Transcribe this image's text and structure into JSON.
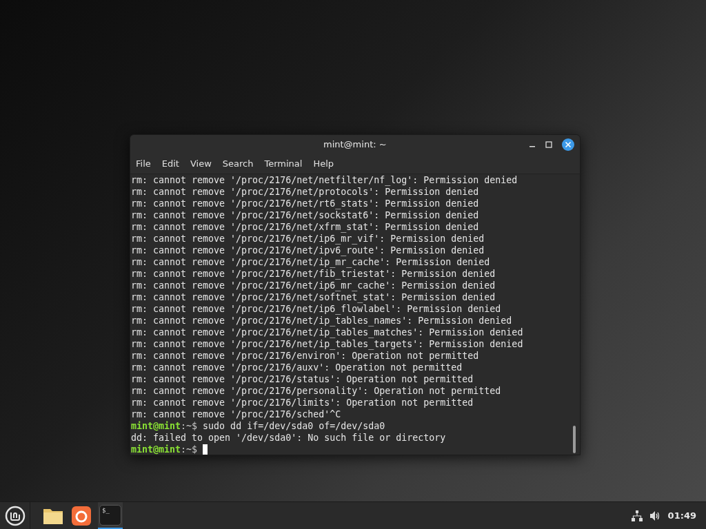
{
  "window": {
    "title": "mint@mint: ~",
    "menu": [
      "File",
      "Edit",
      "View",
      "Search",
      "Terminal",
      "Help"
    ]
  },
  "terminal": {
    "lines": [
      {
        "kind": "output",
        "text": "rm: cannot remove '/proc/2176/net/netfilter/nf_log': Permission denied"
      },
      {
        "kind": "output",
        "text": "rm: cannot remove '/proc/2176/net/protocols': Permission denied"
      },
      {
        "kind": "output",
        "text": "rm: cannot remove '/proc/2176/net/rt6_stats': Permission denied"
      },
      {
        "kind": "output",
        "text": "rm: cannot remove '/proc/2176/net/sockstat6': Permission denied"
      },
      {
        "kind": "output",
        "text": "rm: cannot remove '/proc/2176/net/xfrm_stat': Permission denied"
      },
      {
        "kind": "output",
        "text": "rm: cannot remove '/proc/2176/net/ip6_mr_vif': Permission denied"
      },
      {
        "kind": "output",
        "text": "rm: cannot remove '/proc/2176/net/ipv6_route': Permission denied"
      },
      {
        "kind": "output",
        "text": "rm: cannot remove '/proc/2176/net/ip_mr_cache': Permission denied"
      },
      {
        "kind": "output",
        "text": "rm: cannot remove '/proc/2176/net/fib_triestat': Permission denied"
      },
      {
        "kind": "output",
        "text": "rm: cannot remove '/proc/2176/net/ip6_mr_cache': Permission denied"
      },
      {
        "kind": "output",
        "text": "rm: cannot remove '/proc/2176/net/softnet_stat': Permission denied"
      },
      {
        "kind": "output",
        "text": "rm: cannot remove '/proc/2176/net/ip6_flowlabel': Permission denied"
      },
      {
        "kind": "output",
        "text": "rm: cannot remove '/proc/2176/net/ip_tables_names': Permission denied"
      },
      {
        "kind": "output",
        "text": "rm: cannot remove '/proc/2176/net/ip_tables_matches': Permission denied"
      },
      {
        "kind": "output",
        "text": "rm: cannot remove '/proc/2176/net/ip_tables_targets': Permission denied"
      },
      {
        "kind": "output",
        "text": "rm: cannot remove '/proc/2176/environ': Operation not permitted"
      },
      {
        "kind": "output",
        "text": "rm: cannot remove '/proc/2176/auxv': Operation not permitted"
      },
      {
        "kind": "output",
        "text": "rm: cannot remove '/proc/2176/status': Operation not permitted"
      },
      {
        "kind": "output",
        "text": "rm: cannot remove '/proc/2176/personality': Operation not permitted"
      },
      {
        "kind": "output",
        "text": "rm: cannot remove '/proc/2176/limits': Operation not permitted"
      },
      {
        "kind": "output",
        "text": "rm: cannot remove '/proc/2176/sched'^C"
      },
      {
        "kind": "prompt",
        "user": "mint@mint",
        "rest": ":~$",
        "command": "sudo dd if=/dev/sda0 of=/dev/sda0"
      },
      {
        "kind": "output",
        "text": "dd: failed to open '/dev/sda0': No such file or directory"
      },
      {
        "kind": "prompt",
        "user": "mint@mint",
        "rest": ":~$",
        "cursor": true
      }
    ]
  },
  "taskbar": {
    "terminal_launcher": {
      "label": "$_",
      "selected": true
    },
    "clock": "01:49"
  }
}
